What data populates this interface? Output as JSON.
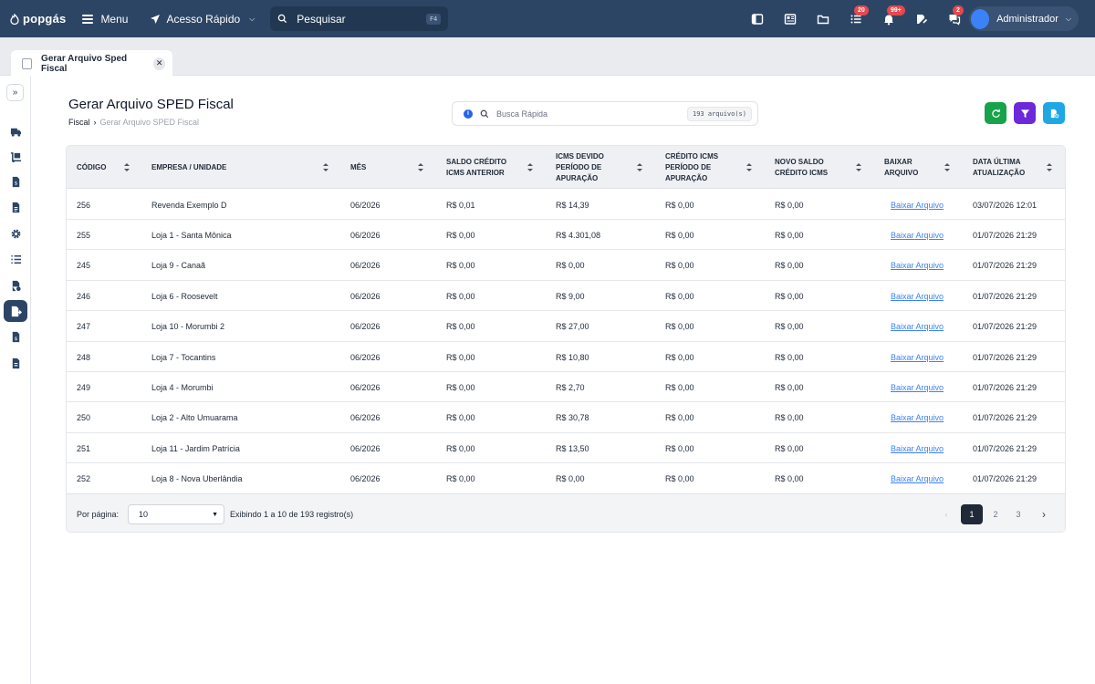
{
  "topbar": {
    "logo": "popgás",
    "menu_label": "Menu",
    "quick_access_label": "Acesso Rápido",
    "search_label": "Pesquisar",
    "search_shortcut": "F4",
    "badges": {
      "tasks": "20",
      "notifications": "99+",
      "chat": "2"
    },
    "user_name": "Administrador"
  },
  "tab": {
    "label": "Gerar Arquivo Sped Fiscal"
  },
  "page": {
    "title": "Gerar Arquivo SPED Fiscal",
    "breadcrumb": {
      "parent": "Fiscal",
      "separator": "›",
      "current": "Gerar Arquivo SPED Fiscal"
    },
    "quick_search_placeholder": "Busca Rápida",
    "file_count": "193 arquivo(s)"
  },
  "colors": {
    "topbar": "#2d4565",
    "refresh": "#16a34a",
    "filter": "#6d28d9",
    "new": "#1ea7e4",
    "link": "#3b82f6"
  },
  "table": {
    "headers": [
      [
        "CÓDIGO"
      ],
      [
        "EMPRESA / UNIDADE"
      ],
      [
        "MÊS"
      ],
      [
        "SALDO CRÉDITO",
        "ICMS ANTERIOR"
      ],
      [
        "ICMS DEVIDO",
        "PERÍODO DE",
        "APURAÇÃO"
      ],
      [
        "CRÉDITO ICMS",
        "PERÍODO DE",
        "APURAÇÃO"
      ],
      [
        "NOVO SALDO",
        "CRÉDITO ICMS"
      ],
      [
        "BAIXAR",
        "ARQUIVO"
      ],
      [
        "DATA ÚLTIMA",
        "ATUALIZAÇÃO"
      ]
    ],
    "rows": [
      [
        "256",
        "Revenda Exemplo D",
        "06/2026",
        "R$ 0,01",
        "R$ 14,39",
        "R$ 0,00",
        "R$ 0,00",
        "Baixar Arquivo",
        "03/07/2026 12:01"
      ],
      [
        "255",
        "Loja 1 - Santa Mônica",
        "06/2026",
        "R$ 0,00",
        "R$ 4.301,08",
        "R$ 0,00",
        "R$ 0,00",
        "Baixar Arquivo",
        "01/07/2026 21:29"
      ],
      [
        "245",
        "Loja 9 - Canaã",
        "06/2026",
        "R$ 0,00",
        "R$ 0,00",
        "R$ 0,00",
        "R$ 0,00",
        "Baixar Arquivo",
        "01/07/2026 21:29"
      ],
      [
        "246",
        "Loja 6 - Roosevelt",
        "06/2026",
        "R$ 0,00",
        "R$ 9,00",
        "R$ 0,00",
        "R$ 0,00",
        "Baixar Arquivo",
        "01/07/2026 21:29"
      ],
      [
        "247",
        "Loja 10 - Morumbi 2",
        "06/2026",
        "R$ 0,00",
        "R$ 27,00",
        "R$ 0,00",
        "R$ 0,00",
        "Baixar Arquivo",
        "01/07/2026 21:29"
      ],
      [
        "248",
        "Loja 7 - Tocantins",
        "06/2026",
        "R$ 0,00",
        "R$ 10,80",
        "R$ 0,00",
        "R$ 0,00",
        "Baixar Arquivo",
        "01/07/2026 21:29"
      ],
      [
        "249",
        "Loja 4 - Morumbi",
        "06/2026",
        "R$ 0,00",
        "R$ 2,70",
        "R$ 0,00",
        "R$ 0,00",
        "Baixar Arquivo",
        "01/07/2026 21:29"
      ],
      [
        "250",
        "Loja 2 - Alto Umuarama",
        "06/2026",
        "R$ 0,00",
        "R$ 30,78",
        "R$ 0,00",
        "R$ 0,00",
        "Baixar Arquivo",
        "01/07/2026 21:29"
      ],
      [
        "251",
        "Loja 11 - Jardim Patrícia",
        "06/2026",
        "R$ 0,00",
        "R$ 13,50",
        "R$ 0,00",
        "R$ 0,00",
        "Baixar Arquivo",
        "01/07/2026 21:29"
      ],
      [
        "252",
        "Loja 8 - Nova Uberlândia",
        "06/2026",
        "R$ 0,00",
        "R$ 0,00",
        "R$ 0,00",
        "R$ 0,00",
        "Baixar Arquivo",
        "01/07/2026 21:29"
      ]
    ]
  },
  "footer": {
    "per_page_label": "Por página:",
    "per_page_value": "10",
    "showing": "Exibindo 1 a 10 de 193 registro(s)",
    "pages": [
      "1",
      "2",
      "3"
    ],
    "current_page": "1"
  }
}
